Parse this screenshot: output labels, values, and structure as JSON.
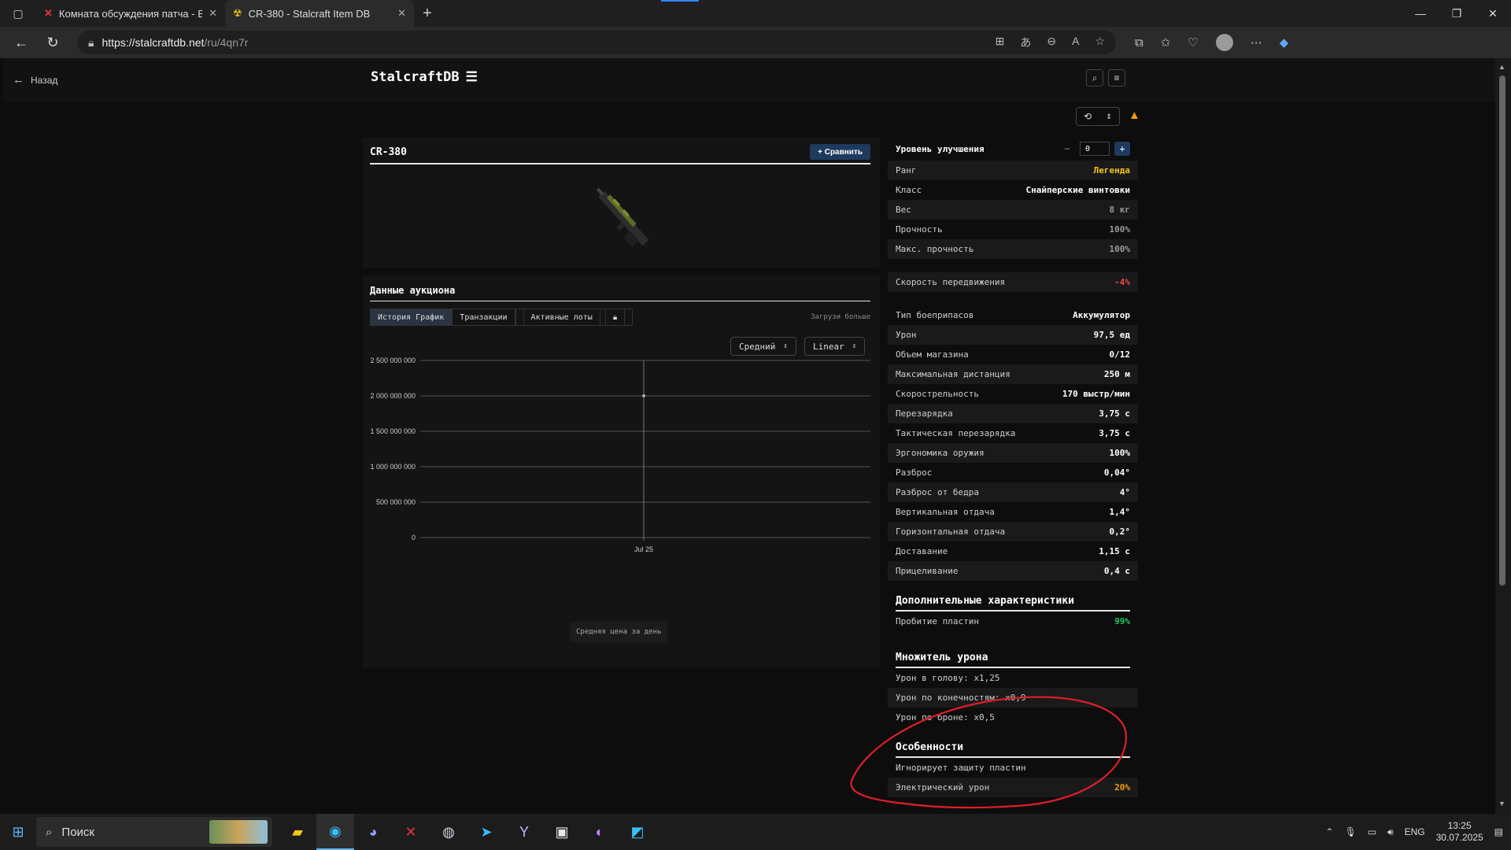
{
  "browser": {
    "tabs": [
      {
        "title": "Комната обсуждения патча - EX",
        "favicon": "x-logo-icon",
        "active": false
      },
      {
        "title": "CR-380 - Stalcraft Item DB",
        "favicon": "radiation-icon",
        "active": true
      }
    ],
    "url_host": "https://stalcraftdb.net",
    "url_path": "/ru/4qn7r"
  },
  "site": {
    "back_label": "Назад",
    "logo": "StalcraftDB"
  },
  "item": {
    "name": "CR-380",
    "compare_label": "+ Сравнить"
  },
  "auction": {
    "title": "Данные аукциона",
    "tabs": [
      "История График",
      "Транзакции",
      "Активные лоты"
    ],
    "load_more": "Загрузи больше",
    "agg_select": "Средний",
    "scale_select": "Linear"
  },
  "chart_data": {
    "type": "scatter",
    "x": [
      "Jul 25"
    ],
    "values": [
      2000000000
    ],
    "yticks": [
      "2 500 000 000",
      "2 000 000 000",
      "1 500 000 000",
      "1 000 000 000",
      "500 000 000",
      "0"
    ],
    "ylim": [
      0,
      2500000000
    ],
    "legend": "Средняя цена за день",
    "title": "",
    "xlabel": "",
    "ylabel": ""
  },
  "stats": {
    "upgrade_label": "Уровень улучшения",
    "upgrade_value": "0",
    "rows1": [
      {
        "label": "Ранг",
        "value": "Легенда",
        "color": "#f5c518"
      },
      {
        "label": "Класс",
        "value": "Снайперские винтовки"
      },
      {
        "label": "Вес",
        "value": "8 кг",
        "color": "#9a9a9a"
      },
      {
        "label": "Прочность",
        "value": "100%",
        "color": "#9a9a9a"
      },
      {
        "label": "Макс. прочность",
        "value": "100%",
        "color": "#9a9a9a"
      }
    ],
    "rows2": [
      {
        "label": "Скорость передвижения",
        "value": "-4%",
        "color": "#ef4444"
      }
    ],
    "rows3": [
      {
        "label": "Тип боеприпасов",
        "value": "Аккумулятор"
      },
      {
        "label": "Урон",
        "value": "97,5 ед"
      },
      {
        "label": "Объем магазина",
        "value": "0/12"
      },
      {
        "label": "Максимальная дистанция",
        "value": "250 м"
      },
      {
        "label": "Скорострельность",
        "value": "170 выстр/мин"
      },
      {
        "label": "Перезарядка",
        "value": "3,75 с"
      },
      {
        "label": "Тактическая перезарядка",
        "value": "3,75 с"
      },
      {
        "label": "Эргономика оружия",
        "value": "100%"
      },
      {
        "label": "Разброс",
        "value": "0,04°"
      },
      {
        "label": "Разброс от бедра",
        "value": "4°"
      },
      {
        "label": "Вертикальная отдача",
        "value": "1,4°"
      },
      {
        "label": "Горизонтальная отдача",
        "value": "0,2°"
      },
      {
        "label": "Доставание",
        "value": "1,15 с"
      },
      {
        "label": "Прицеливание",
        "value": "0,4 с"
      }
    ],
    "extra_title": "Дополнительные характеристики",
    "extra_rows": [
      {
        "label": "Пробитие пластин",
        "value": "99%",
        "color": "#22c55e"
      }
    ],
    "dmg_title": "Множитель урона",
    "dmg_rows": [
      {
        "label": "Урон в голову: x1,25"
      },
      {
        "label": "Урон по конечностям: x0,9"
      },
      {
        "label": "Урон по броне: x0,5"
      }
    ],
    "feat_title": "Особенности",
    "feat_rows": [
      {
        "label": "Игнорирует защиту пластин"
      },
      {
        "label": "Электрический урон",
        "value": "20%",
        "color": "#f59e0b"
      }
    ]
  },
  "taskbar": {
    "search_label": "Поиск",
    "lang": "ENG",
    "time": "13:25",
    "date": "30.07.2025"
  }
}
